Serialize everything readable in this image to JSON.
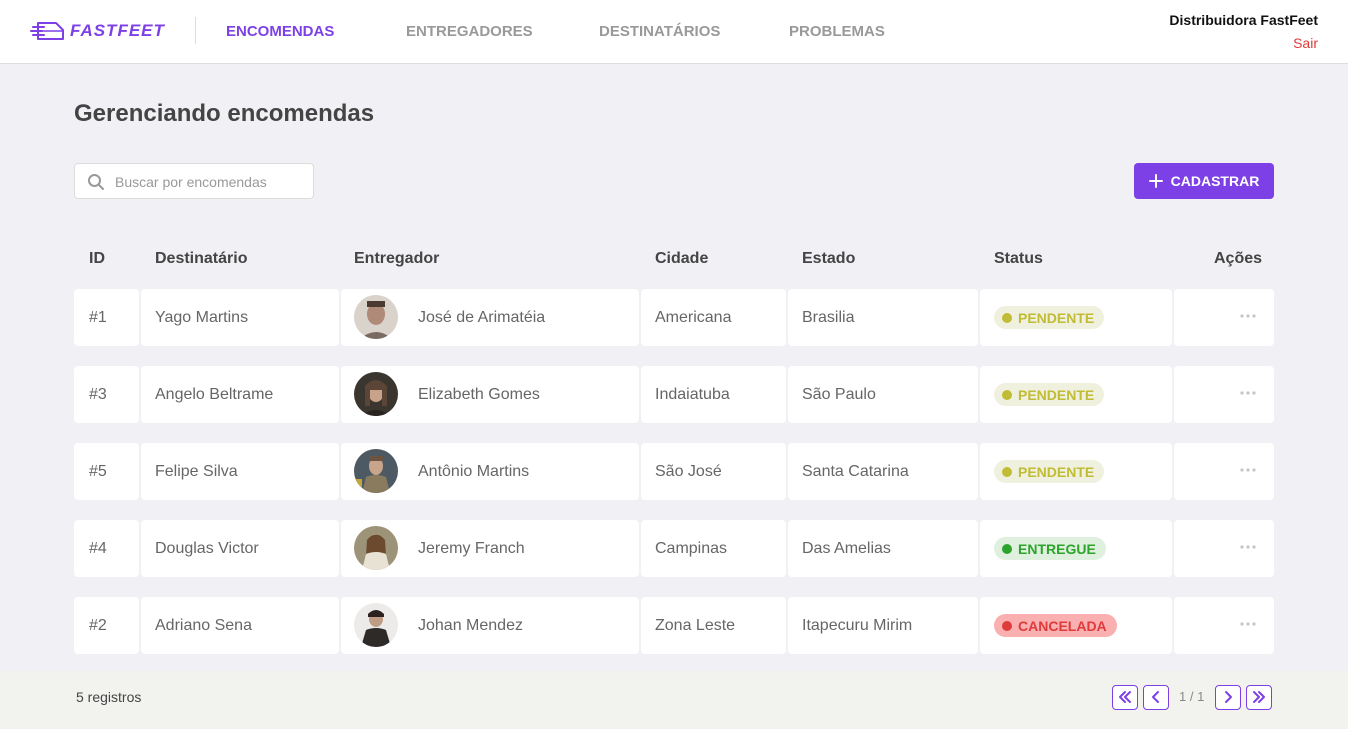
{
  "header": {
    "logo_text": "FASTFEET",
    "nav": [
      {
        "label": "ENCOMENDAS",
        "active": true
      },
      {
        "label": "ENTREGADORES",
        "active": false
      },
      {
        "label": "DESTINATÁRIOS",
        "active": false
      },
      {
        "label": "PROBLEMAS",
        "active": false
      }
    ],
    "user_name": "Distribuidora FastFeet",
    "logout_label": "Sair"
  },
  "main": {
    "title": "Gerenciando encomendas",
    "search": {
      "placeholder": "Buscar por encomendas",
      "value": ""
    },
    "add_button_label": "CADASTRAR"
  },
  "table": {
    "columns": [
      "ID",
      "Destinatário",
      "Entregador",
      "Cidade",
      "Estado",
      "Status",
      "Ações"
    ],
    "rows": [
      {
        "id": "#1",
        "recipient": "Yago Martins",
        "deliveryman": "José de Arimatéia",
        "city": "Americana",
        "state": "Brasilia",
        "status": "PENDENTE"
      },
      {
        "id": "#3",
        "recipient": "Angelo Beltrame",
        "deliveryman": "Elizabeth Gomes",
        "city": "Indaiatuba",
        "state": "São Paulo",
        "status": "PENDENTE"
      },
      {
        "id": "#5",
        "recipient": "Felipe Silva",
        "deliveryman": "Antônio Martins",
        "city": "São José",
        "state": "Santa Catarina",
        "status": "PENDENTE"
      },
      {
        "id": "#4",
        "recipient": "Douglas Victor",
        "deliveryman": "Jeremy Franch",
        "city": "Campinas",
        "state": "Das Amelias",
        "status": "ENTREGUE"
      },
      {
        "id": "#2",
        "recipient": "Adriano Sena",
        "deliveryman": "Johan Mendez",
        "city": "Zona Leste",
        "state": "Itapecuru Mirim",
        "status": "CANCELADA"
      }
    ]
  },
  "status_colors": {
    "PENDENTE": {
      "bg": "#f0f0df",
      "fg": "#c1bc35"
    },
    "ENTREGUE": {
      "bg": "#dff0df",
      "fg": "#2ca42b"
    },
    "CANCELADA": {
      "bg": "#fab0b0",
      "fg": "#de3b3b"
    }
  },
  "footer": {
    "count_label": "5 registros",
    "page_indicator": "1 / 1"
  },
  "colors": {
    "accent": "#7d40e7",
    "danger": "#de3b3b"
  },
  "icons": [
    "logo-truck-icon",
    "search-icon",
    "plus-icon",
    "more-horizontal-icon",
    "chevrons-left-icon",
    "chevron-left-icon",
    "chevron-right-icon",
    "chevrons-right-icon"
  ]
}
